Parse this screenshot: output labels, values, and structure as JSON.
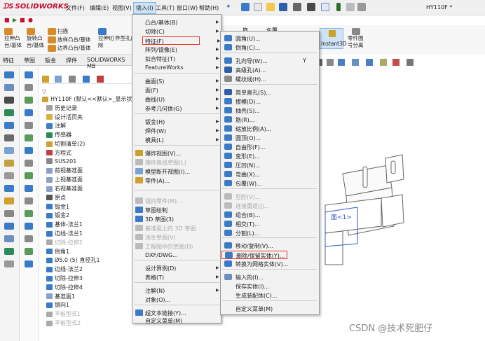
{
  "app": {
    "logo": "SOLIDWORKS",
    "doc_title": "HY110F *"
  },
  "menubar": [
    "文件(F)",
    "编辑(E)",
    "视图(V)",
    "插入(I)",
    "工具(T)",
    "窗口(W)",
    "帮助(H)"
  ],
  "commands": {
    "extrude_boss": [
      "拉伸凸",
      "台/基体"
    ],
    "revolve_boss": [
      "旋转凸",
      "台/基体"
    ],
    "sweep": "扫描",
    "loft": "放样凸台/基体",
    "boundary": "边界凸台/基体",
    "extrude_cut": [
      "拉伸切",
      "除"
    ],
    "hole": "异型孔向",
    "instant3d": "Instant3D",
    "part_split": [
      "零件图",
      "号分离"
    ],
    "fragment1": "筋",
    "fragment2": "包覆"
  },
  "tabs": [
    "特征",
    "草图",
    "钣金",
    "焊件",
    "SOLIDWORKS MB"
  ],
  "tree": [
    {
      "label": "HY110F (默认<<默认>_显示状态",
      "gray": false
    },
    {
      "label": "历史记录",
      "gray": false
    },
    {
      "label": "设计活页夹",
      "gray": false
    },
    {
      "label": "注解",
      "gray": false
    },
    {
      "label": "传感器",
      "gray": false
    },
    {
      "label": "切割清单(2)",
      "gray": false
    },
    {
      "label": "方程式",
      "gray": false
    },
    {
      "label": "SUS201",
      "gray": false
    },
    {
      "label": "前视基准面",
      "gray": false
    },
    {
      "label": "上视基准面",
      "gray": false
    },
    {
      "label": "右视基准面",
      "gray": false
    },
    {
      "label": "原点",
      "gray": false
    },
    {
      "label": "钣金1",
      "gray": false
    },
    {
      "label": "钣金2",
      "gray": false
    },
    {
      "label": "基体-法兰1",
      "gray": false
    },
    {
      "label": "边线-法兰1",
      "gray": false
    },
    {
      "label": "切除-拉伸2",
      "gray": true
    },
    {
      "label": "倒角1",
      "gray": false
    },
    {
      "label": "Ø5.0 (5) 直径孔1",
      "gray": false
    },
    {
      "label": "边线-法兰2",
      "gray": false
    },
    {
      "label": "切除-拉伸3",
      "gray": false
    },
    {
      "label": "切除-拉伸4",
      "gray": false
    },
    {
      "label": "基准面1",
      "gray": false
    },
    {
      "label": "镜向1",
      "gray": false
    },
    {
      "label": "平板型式1",
      "gray": true
    },
    {
      "label": "平板型式2",
      "gray": true
    }
  ],
  "insert_menu": [
    {
      "label": "凸台/基体(B)",
      "arrow": true,
      "gray": false
    },
    {
      "label": "切除(C)",
      "arrow": true,
      "gray": false
    },
    {
      "label": "特征(F)",
      "arrow": true,
      "gray": false,
      "highlight": true
    },
    {
      "label": "阵列/镜像(E)",
      "arrow": true,
      "gray": false
    },
    {
      "label": "扣合特征(T)",
      "arrow": true,
      "gray": false
    },
    {
      "label": "FeatureWorks",
      "arrow": true,
      "gray": false
    },
    {
      "label": "曲面(S)",
      "arrow": true,
      "gray": false
    },
    {
      "label": "面(F)",
      "arrow": true,
      "gray": false
    },
    {
      "label": "曲线(U)",
      "arrow": true,
      "gray": false
    },
    {
      "label": "参考几何体(G)",
      "arrow": true,
      "gray": false
    },
    {
      "label": "钣金(H)",
      "arrow": true,
      "gray": false
    },
    {
      "label": "焊件(W)",
      "arrow": true,
      "gray": false
    },
    {
      "label": "模具(L)",
      "arrow": true,
      "gray": false
    },
    {
      "label": "爆炸视图(V)...",
      "arrow": false,
      "gray": false
    },
    {
      "label": "爆炸直线草图(L)",
      "arrow": false,
      "gray": true
    },
    {
      "label": "模型断开视图(I)...",
      "arrow": false,
      "gray": false
    },
    {
      "label": "零件(A)...",
      "arrow": false,
      "gray": false
    },
    {
      "label": "镜向零件(M)...",
      "arrow": false,
      "gray": true
    },
    {
      "label": "草图绘制",
      "arrow": false,
      "gray": false
    },
    {
      "label": "3D 草图(3)",
      "arrow": false,
      "gray": false
    },
    {
      "label": "基准面上的 3D 草图",
      "arrow": false,
      "gray": true
    },
    {
      "label": "派生草图(V)",
      "arrow": false,
      "gray": true
    },
    {
      "label": "工程图中的草图(D)",
      "arrow": false,
      "gray": true
    },
    {
      "label": "DXF/DWG...",
      "arrow": false,
      "gray": false
    },
    {
      "label": "设计算例(D)",
      "arrow": true,
      "gray": false
    },
    {
      "label": "表格(T)",
      "arrow": true,
      "gray": false
    },
    {
      "label": "注解(N)",
      "arrow": true,
      "gray": false
    },
    {
      "label": "对象(O)...",
      "arrow": false,
      "gray": false
    },
    {
      "label": "超文本链接(Y)...",
      "arrow": false,
      "gray": false
    },
    {
      "label": "自定义菜单(M)",
      "arrow": false,
      "gray": false
    }
  ],
  "feature_menu": [
    {
      "label": "圆角(U)...",
      "gray": false
    },
    {
      "label": "倒角(C)...",
      "gray": false
    },
    {
      "label": "孔向导(W)...",
      "gray": false
    },
    {
      "label": "高级孔(A)...",
      "gray": false
    },
    {
      "label": "螺纹线(H)...",
      "gray": false
    },
    {
      "label": "简单直孔(S)...",
      "gray": false
    },
    {
      "label": "拔模(D)...",
      "gray": false
    },
    {
      "label": "抽壳(S)...",
      "gray": false
    },
    {
      "label": "筋(R)...",
      "gray": false
    },
    {
      "label": "缩放比例(A)...",
      "gray": false
    },
    {
      "label": "圆顶(O)...",
      "gray": false
    },
    {
      "label": "自由形(F)...",
      "gray": false
    },
    {
      "label": "变形(E)...",
      "gray": false
    },
    {
      "label": "压凹(N)...",
      "gray": false
    },
    {
      "label": "弯曲(X)...",
      "gray": false
    },
    {
      "label": "包覆(W)...",
      "gray": false
    },
    {
      "label": "型腔(V)...",
      "gray": true
    },
    {
      "label": "连接重组(J)...",
      "gray": true
    },
    {
      "label": "组合(B)...",
      "gray": false
    },
    {
      "label": "相交(T)...",
      "gray": false
    },
    {
      "label": "分割(L)...",
      "gray": false
    },
    {
      "label": "移动/复制(V)...",
      "gray": false
    },
    {
      "label": "删除/保留实体(Y)...",
      "gray": false,
      "highlight": true
    },
    {
      "label": "转换为网格实体(V)...",
      "gray": false
    },
    {
      "label": "输入的(I)...",
      "gray": false
    },
    {
      "label": "保存实体(I)...",
      "gray": false
    },
    {
      "label": "生成装配体(C)...",
      "gray": false
    },
    {
      "label": "自定义菜单(M)",
      "gray": false
    }
  ],
  "feature_menu_shortcut": "Y",
  "viewport_label": "面<1>",
  "watermark": "CSDN @技术死肥仔",
  "colors": {
    "menu_highlight": "#e53935",
    "accent": "#1e6fc8",
    "brand": "#c8102e"
  }
}
